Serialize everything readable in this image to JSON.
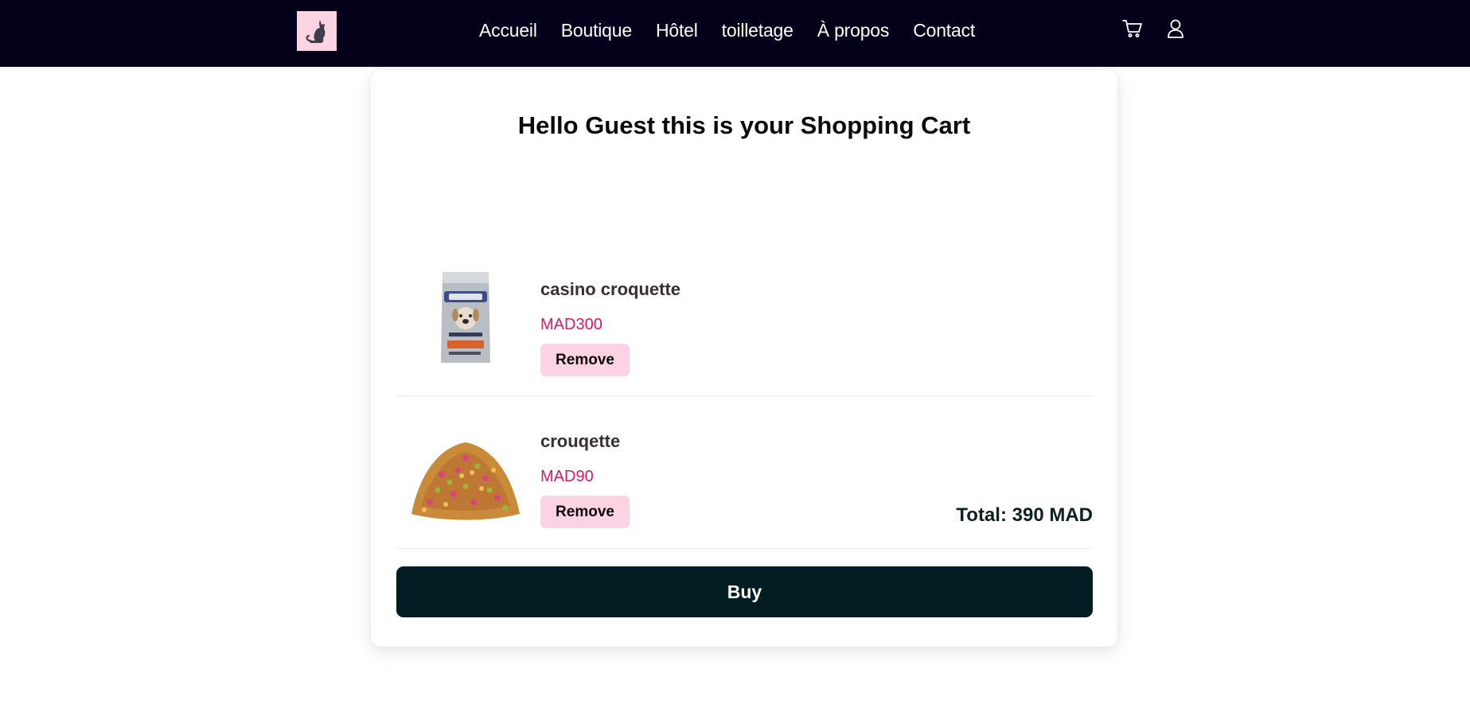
{
  "nav": {
    "logo_icon": "cat-icon",
    "links": [
      "Accueil",
      "Boutique",
      "Hôtel",
      "toilletage",
      "À propos",
      "Contact"
    ],
    "cart_icon": "cart-icon",
    "user_icon": "user-icon"
  },
  "cart": {
    "title": "Hello Guest this is your Shopping Cart",
    "items": [
      {
        "name": "casino croquette",
        "price": "MAD300",
        "remove_label": "Remove",
        "image_icon": "dog-food-bag-image"
      },
      {
        "name": "crouqette",
        "price": "MAD90",
        "remove_label": "Remove",
        "image_icon": "kibble-pile-image"
      }
    ],
    "total": "Total: 390 MAD",
    "buy_label": "Buy"
  },
  "colors": {
    "navbar_bg": "#04001a",
    "accent_pink": "#fcd3e3",
    "price_pink": "#d81b60",
    "buy_bg": "#021d21"
  }
}
